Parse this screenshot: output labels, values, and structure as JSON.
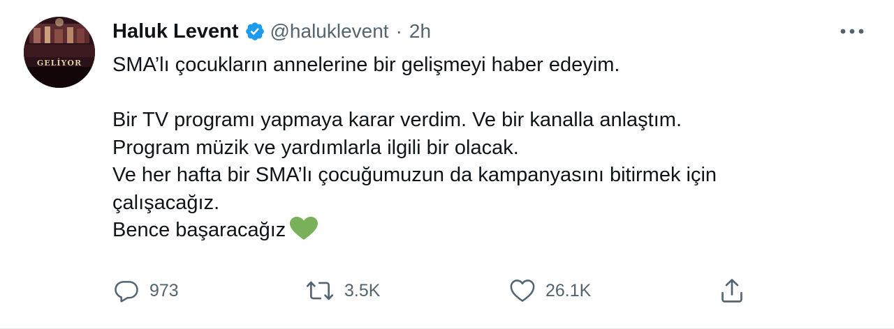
{
  "author": {
    "display_name": "Haluk Levent",
    "handle": "@haluklevent",
    "separator": "·",
    "timestamp": "2h",
    "avatar_text": "GELİYOR"
  },
  "tweet": {
    "lines": [
      "SMA’lı çocukların annelerine bir gelişmeyi haber edeyim.",
      "",
      "Bir TV programı yapmaya karar verdim. Ve bir kanalla anlaştım.",
      "Program müzik ve yardımlarla ilgili bir  olacak.",
      "Ve her hafta bir SMA’lı çocuğumuzun da kampanyasını bitirmek için",
      "çalışacağız.",
      "Bence başaracağız"
    ],
    "emoji": "green-heart"
  },
  "actions": {
    "reply_count": "973",
    "retweet_count": "3.5K",
    "like_count": "26.1K"
  },
  "colors": {
    "verified_blue": "#1d9bf0",
    "secondary_text": "#536471",
    "heart_green": "#78b159"
  }
}
